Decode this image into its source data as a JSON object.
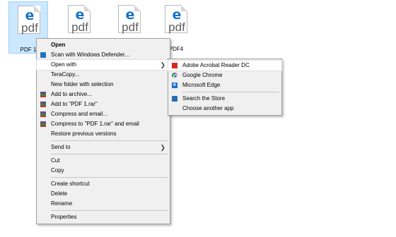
{
  "files": [
    {
      "label": "PDF 1",
      "doc_letter": "e",
      "doc_text": "pdf"
    },
    {
      "label": "",
      "doc_letter": "e",
      "doc_text": "pdf"
    },
    {
      "label": "",
      "doc_letter": "e",
      "doc_text": "pdf"
    },
    {
      "label": "PDF4",
      "doc_letter": "e",
      "doc_text": "pdf"
    }
  ],
  "context_menu": {
    "open": "Open",
    "scan": "Scan with Windows Defender...",
    "open_with": "Open with",
    "teracopy": "TeraCopy...",
    "new_folder": "New folder with selection",
    "add_archive": "Add to archive...",
    "add_rar": "Add to \"PDF 1.rar\"",
    "compress_email": "Compress and email...",
    "compress_rar_email": "Compress to \"PDF 1.rar\" and email",
    "restore": "Restore previous versions",
    "send_to": "Send to",
    "cut": "Cut",
    "copy": "Copy",
    "create_shortcut": "Create shortcut",
    "delete": "Delete",
    "rename": "Rename",
    "properties": "Properties"
  },
  "open_with_menu": {
    "acrobat": "Adobe Acrobat Reader DC",
    "chrome": "Google Chrome",
    "edge": "Microsoft Edge",
    "store": "Search the Store",
    "choose": "Choose another app"
  },
  "colors": {
    "selection_bg": "#cce8ff",
    "menu_bg": "#f0f0f0",
    "edge_blue": "#1a73c8",
    "acrobat_red": "#d7261e"
  },
  "icons": {
    "submenu_arrow": "chevron-right-icon",
    "edge_letter": "e"
  }
}
